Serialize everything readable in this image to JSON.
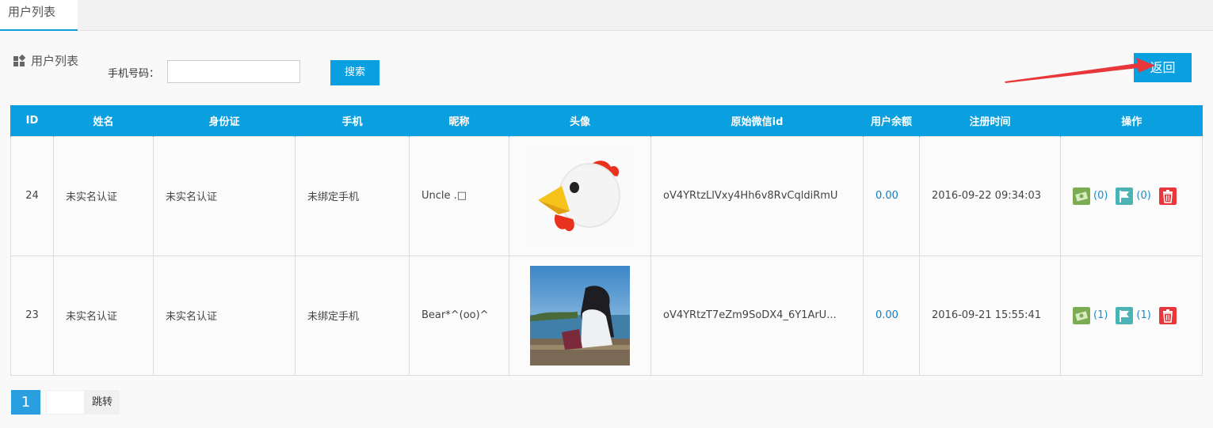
{
  "tab": {
    "label": "用户列表"
  },
  "section": {
    "title": "用户列表"
  },
  "search": {
    "label": "手机号码：",
    "value": "",
    "placeholder": "",
    "button": "搜索"
  },
  "back_button": "返回",
  "table": {
    "headers": [
      "ID",
      "姓名",
      "身份证",
      "手机",
      "昵称",
      "头像",
      "原始微信id",
      "用户余额",
      "注册时间",
      "操作"
    ],
    "rows": [
      {
        "id": "24",
        "name": "未实名认证",
        "id_card": "未实名认证",
        "phone": "未绑定手机",
        "nickname": "Uncle .□",
        "avatar": "chicken-emoji-avatar",
        "wechat_id": "oV4YRtzLlVxy4Hh6v8RvCqldiRmU",
        "balance": "0.00",
        "reg_time": "2016-09-22 09:34:03",
        "op1_count": "(0)",
        "op2_count": "(0)"
      },
      {
        "id": "23",
        "name": "未实名认证",
        "id_card": "未实名认证",
        "phone": "未绑定手机",
        "nickname": "Bear*^(oo)^",
        "avatar": "photo-girl-harbor-avatar",
        "wechat_id": "oV4YRtzT7eZm9SoDX4_6Y1ArU...",
        "balance": "0.00",
        "reg_time": "2016-09-21 15:55:41",
        "op1_count": "(1)",
        "op2_count": "(1)"
      }
    ]
  },
  "pager": {
    "current": "1",
    "go_label": "跳转"
  },
  "colors": {
    "primary": "#0aa0e0",
    "link": "#1a8cd0",
    "delete": "#e8373a",
    "op_green": "#7bab52",
    "op_teal": "#4bb3b3"
  }
}
